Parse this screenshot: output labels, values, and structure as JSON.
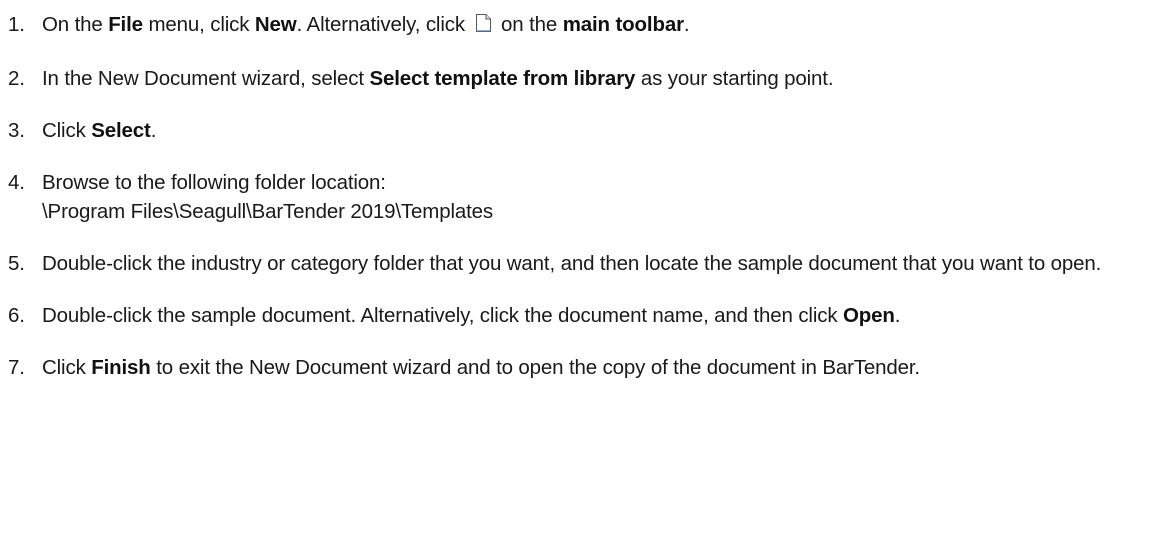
{
  "steps": [
    {
      "number": "1.",
      "t1": "On the ",
      "b1": "File",
      "t2": " menu, click ",
      "b2": "New",
      "t3": ". Alternatively, click ",
      "icon": "new-document-icon",
      "t4": " on the ",
      "b3": "main toolbar",
      "t5": "."
    },
    {
      "number": "2.",
      "t1": "In the New Document wizard, select ",
      "b1": "Select template from library",
      "t2": " as your starting point."
    },
    {
      "number": "3.",
      "t1": "Click ",
      "b1": "Select",
      "t2": "."
    },
    {
      "number": "4.",
      "t1": "Browse to the following folder location:",
      "path": "\\Program Files\\Seagull\\BarTender 2019\\Templates"
    },
    {
      "number": "5.",
      "t1": "Double-click the industry or category folder that you want, and then locate the sample document that you want to open."
    },
    {
      "number": "6.",
      "t1": "Double-click the sample document. Alternatively, click the document name, and then click ",
      "b1": "Open",
      "t2": "."
    },
    {
      "number": "7.",
      "t1": "Click ",
      "b1": "Finish",
      "t2": " to exit the New Document wizard and to open the copy of the document in BarTender."
    }
  ]
}
